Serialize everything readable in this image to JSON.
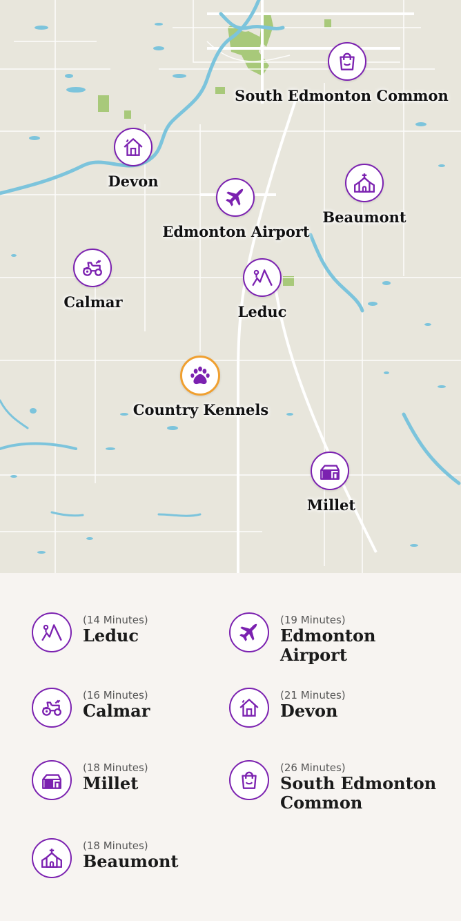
{
  "colors": {
    "accent": "#7b21b0",
    "home_ring": "#f0a030",
    "water": "#7cc4dc",
    "park": "#a8c97a",
    "land": "#e8e6dc",
    "road": "#ffffff"
  },
  "map": {
    "markers": {
      "south_edmonton_common": {
        "label": "South Edmonton Common",
        "icon": "shopping-bag-icon"
      },
      "devon": {
        "label": "Devon",
        "icon": "house-icon"
      },
      "edmonton_airport": {
        "label": "Edmonton Airport",
        "icon": "airplane-icon"
      },
      "beaumont": {
        "label": "Beaumont",
        "icon": "church-icon"
      },
      "calmar": {
        "label": "Calmar",
        "icon": "tractor-icon"
      },
      "leduc": {
        "label": "Leduc",
        "icon": "mountain-icon"
      },
      "country_kennels": {
        "label": "Country Kennels",
        "icon": "paw-icon"
      },
      "millet": {
        "label": "Millet",
        "icon": "barn-icon"
      }
    }
  },
  "list": {
    "leduc": {
      "minutes": "(14 Minutes)",
      "name": "Leduc",
      "icon": "mountain-icon"
    },
    "edmonton_airport": {
      "minutes": "(19 Minutes)",
      "name": "Edmonton Airport",
      "icon": "airplane-icon"
    },
    "calmar": {
      "minutes": "(16 Minutes)",
      "name": "Calmar",
      "icon": "tractor-icon"
    },
    "devon": {
      "minutes": "(21 Minutes)",
      "name": "Devon",
      "icon": "house-icon"
    },
    "millet": {
      "minutes": "(18 Minutes)",
      "name": "Millet",
      "icon": "barn-icon"
    },
    "south_edmonton_common": {
      "minutes": "(26 Minutes)",
      "name": "South Edmonton Common",
      "icon": "shopping-bag-icon"
    },
    "beaumont": {
      "minutes": "(18 Minutes)",
      "name": "Beaumont",
      "icon": "church-icon"
    }
  }
}
